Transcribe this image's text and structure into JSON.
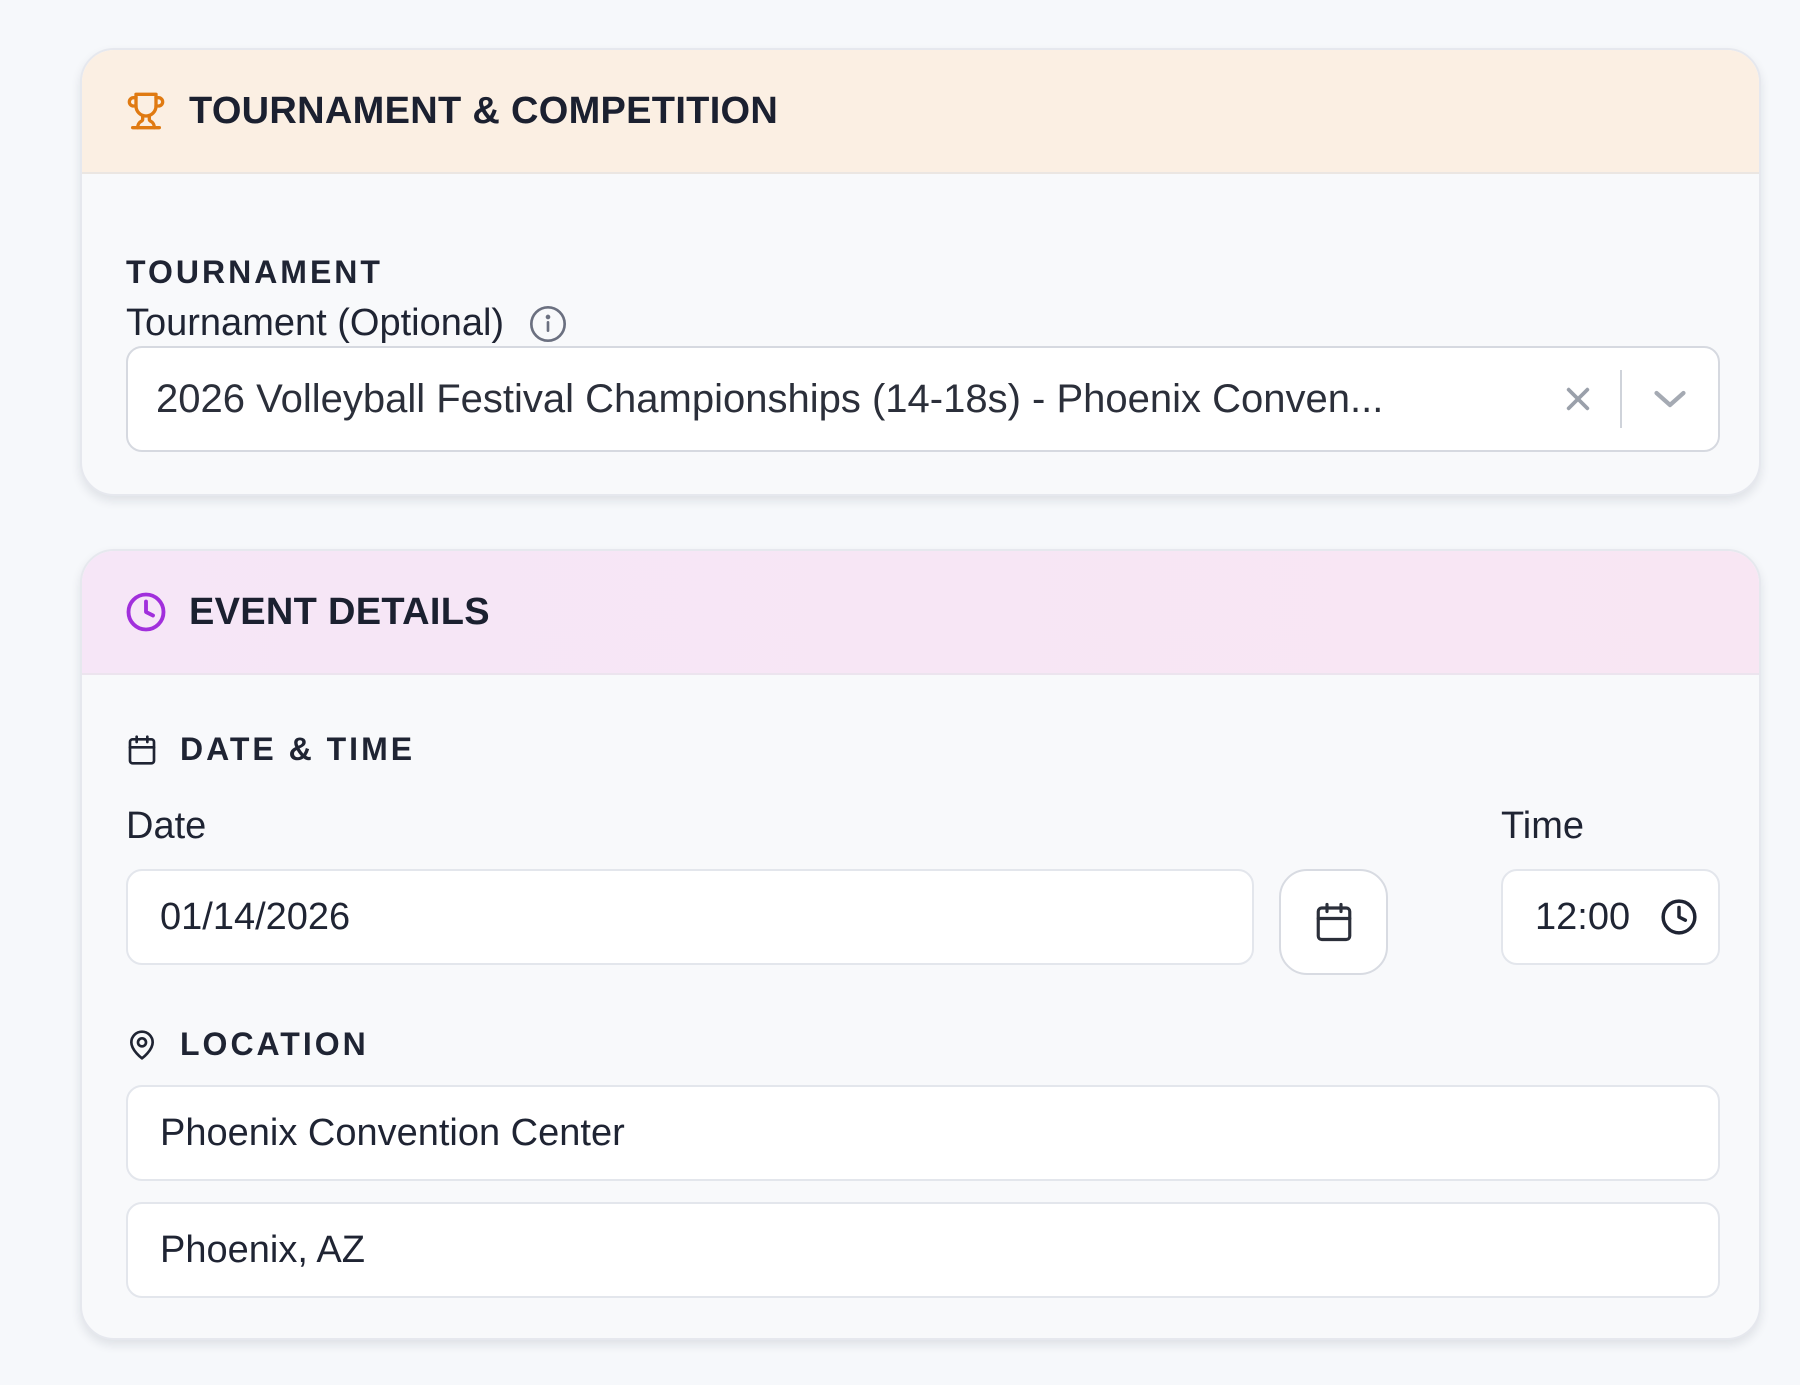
{
  "tournament_card": {
    "title": "TOURNAMENT & COMPETITION",
    "icon": "trophy-icon",
    "section_label": "TOURNAMENT",
    "field_label": "Tournament (Optional)",
    "selected_value": "2026 Volleyball Festival Championships (14-18s) - Phoenix Conven...",
    "accent_color": "#e07a12"
  },
  "event_card": {
    "title": "EVENT DETAILS",
    "icon": "clock-icon",
    "accent_color": "#a12fdc",
    "date_time": {
      "section_label": "DATE & TIME",
      "date_label": "Date",
      "date_value": "01/14/2026",
      "time_label": "Time",
      "time_value": "12:00"
    },
    "location": {
      "section_label": "LOCATION",
      "venue_value": "Phoenix Convention Center",
      "city_value": "Phoenix, AZ"
    }
  }
}
